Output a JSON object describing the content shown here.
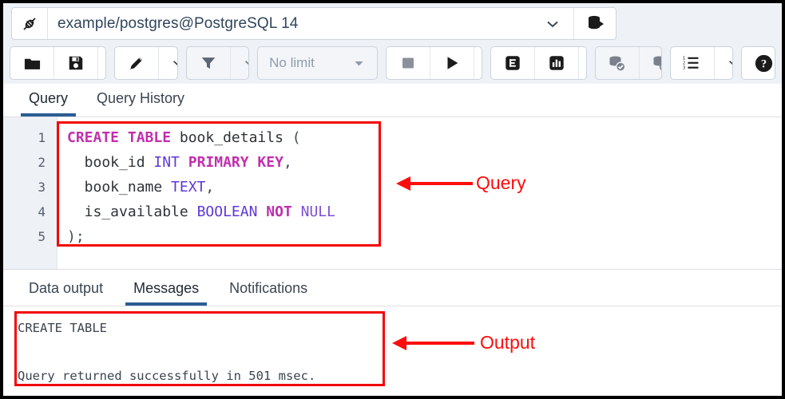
{
  "window": {
    "app": "pgAdmin Query Tool",
    "border_color": "#000000"
  },
  "connection_bar": {
    "connection_icon": "plug-connected-icon",
    "title": "example/postgres@PostgreSQL 14",
    "dropdown_icon": "chevron-down-icon",
    "database_icon": "connect-database-icon"
  },
  "toolbar": {
    "open_file_label": "folder-open-icon",
    "save_file_label": "save-icon",
    "save_dropdown_label": "chevron-down-icon",
    "edit_label": "pencil-edit-icon",
    "edit_dropdown_label": "chevron-down-icon",
    "filter_label": "filter-icon",
    "filter_dropdown_label": "chevron-down-icon",
    "limit_value": "No limit",
    "limit_caret": "caret-down-icon",
    "stop_label": "stop-square-icon",
    "execute_label": "play-execute-icon",
    "execute_dropdown_label": "chevron-down-icon",
    "explain_label": "E",
    "explain_analyze_label": "bar-chart-icon",
    "explain_dropdown_label": "chevron-down-icon",
    "commit_label": "database-commit-icon",
    "rollback_label": "database-rollback-icon",
    "macros_label": "numbered-list-icon",
    "macros_caret": "chevron-down-icon",
    "help_label": "help-question-icon"
  },
  "query_tabs": [
    {
      "label": "Query",
      "active": true
    },
    {
      "label": "Query History",
      "active": false
    }
  ],
  "editor": {
    "line_numbers": [
      "1",
      "2",
      "3",
      "4",
      "5"
    ],
    "lines": [
      [
        {
          "t": "CREATE TABLE",
          "c": "kw"
        },
        {
          "t": " book_details ",
          "c": "ident"
        },
        {
          "t": "(",
          "c": "punct"
        }
      ],
      [
        {
          "t": "  book_id ",
          "c": "ident"
        },
        {
          "t": "INT",
          "c": "type"
        },
        {
          "t": " ",
          "c": "ident"
        },
        {
          "t": "PRIMARY KEY",
          "c": "kw"
        },
        {
          "t": ",",
          "c": "punct"
        }
      ],
      [
        {
          "t": "  book_name ",
          "c": "ident"
        },
        {
          "t": "TEXT",
          "c": "type"
        },
        {
          "t": ",",
          "c": "punct"
        }
      ],
      [
        {
          "t": "  is_available ",
          "c": "ident"
        },
        {
          "t": "BOOLEAN",
          "c": "type"
        },
        {
          "t": " ",
          "c": "ident"
        },
        {
          "t": "NOT",
          "c": "kw"
        },
        {
          "t": " ",
          "c": "ident"
        },
        {
          "t": "NULL",
          "c": "type2"
        }
      ],
      [
        {
          "t": ");",
          "c": "punct"
        }
      ]
    ],
    "plain_text": "CREATE TABLE book_details (\n  book_id INT PRIMARY KEY,\n  book_name TEXT,\n  is_available BOOLEAN NOT NULL\n);"
  },
  "lower_tabs": [
    {
      "label": "Data output",
      "active": false
    },
    {
      "label": "Messages",
      "active": true
    },
    {
      "label": "Notifications",
      "active": false
    }
  ],
  "messages": {
    "line1": "CREATE TABLE",
    "line2": "",
    "line3": "Query returned successfully in 501 msec."
  },
  "annotations": {
    "accent_color": "#fd0d0d",
    "query_label": "Query",
    "output_label": "Output"
  }
}
